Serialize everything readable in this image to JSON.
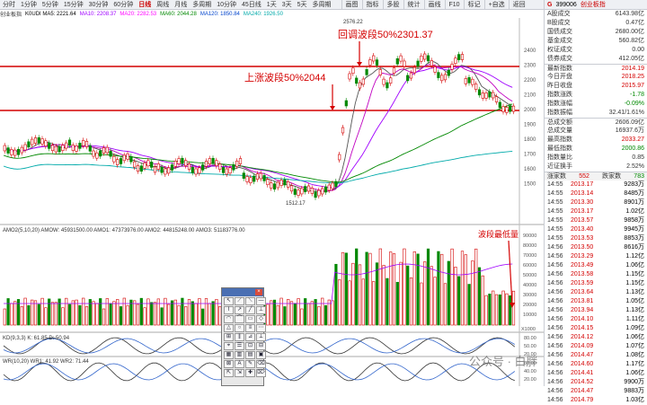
{
  "timeframes": [
    "分时",
    "1分钟",
    "5分钟",
    "15分钟",
    "30分钟",
    "60分钟",
    "日线",
    "周线",
    "月线",
    "多周期",
    "10分钟",
    "45日线",
    "1天",
    "3天",
    "5天",
    "多周期"
  ],
  "active_timeframe": "日线",
  "toolbar": [
    "画图",
    "指标",
    "多股",
    "统计",
    "画线",
    "F10",
    "标记",
    "+自选",
    "返回"
  ],
  "index_info": {
    "label": "创业板指",
    "ma_line": "K0UDI MA5: 2221.64",
    "ma10": "MA10: 2208.37",
    "ma20": "MA20: 2282.53",
    "ma60": "MA60: 2044.28",
    "ma120": "MA120: 1850.84",
    "ma250": "MA240: 1926.50"
  },
  "annotations": {
    "callback": "回调波段50%2301.37",
    "rise": "上涨波段50%2044",
    "peak": "2576.22",
    "low": "1512.17",
    "low_vol": "波段最低量"
  },
  "price_axis": [
    "2400",
    "2300",
    "2200",
    "2100",
    "2000",
    "1900",
    "1800",
    "1700",
    "1600",
    "1500"
  ],
  "vol_axis": [
    "90000",
    "80000",
    "70000",
    "60000",
    "50000",
    "40000",
    "30000",
    "20000",
    "10000"
  ],
  "vol_unit": "X1000",
  "indicators": {
    "vol": "AMO2(5,10,20)  AMOW: 45931500.00  AMO1: 47373976.00  AMO2: 44815248.00  AMO3: 51183776.00",
    "kdj": "KD(9,3,3)  K: 61.85  D: 50.94",
    "wr": "WR(10,20)  WR1: 41.92  WR2: 71.44",
    "kdj_axis": [
      "80.00",
      "50.00",
      "20.00"
    ],
    "wr_axis": [
      "80.00",
      "40.00",
      "20.00"
    ]
  },
  "right_panel": {
    "flag": "G",
    "code": "399006",
    "name": "创业板指",
    "stats": [
      {
        "label": "A股成交",
        "value": "6143.98亿"
      },
      {
        "label": "B股成交",
        "value": "0.47亿"
      },
      {
        "label": "国债成交",
        "value": "2680.00亿"
      },
      {
        "label": "基金成交",
        "value": "560.82亿"
      },
      {
        "label": "权证成交",
        "value": "0.00"
      },
      {
        "label": "债券成交",
        "value": "412.05亿"
      },
      {
        "label": "最新指数",
        "value": "2014.19"
      },
      {
        "label": "今日开盘",
        "value": "2018.25"
      },
      {
        "label": "昨日收盘",
        "value": "2015.97"
      },
      {
        "label": "指数涨跌",
        "value": "-1.78"
      },
      {
        "label": "指数涨幅",
        "value": "-0.09%"
      },
      {
        "label": "指数振幅",
        "value": "32.41/1.61%"
      },
      {
        "label": "总成交额",
        "value": "2606.09亿"
      },
      {
        "label": "总成交量",
        "value": "16937.6万"
      },
      {
        "label": "最高指数",
        "value": "2033.27"
      },
      {
        "label": "最低指数",
        "value": "2000.86"
      },
      {
        "label": "指数量比",
        "value": "0.85"
      },
      {
        "label": "近证换手",
        "value": "2.52%"
      }
    ],
    "rise_label": "涨家数",
    "rise_value": "552",
    "fall_label": "跌家数",
    "fall_value": "783",
    "ticks": [
      {
        "t": "14:55",
        "p": "2013.17",
        "q": "9283万"
      },
      {
        "t": "14:55",
        "p": "2013.14",
        "q": "8485万"
      },
      {
        "t": "14:55",
        "p": "2013.30",
        "q": "8901万"
      },
      {
        "t": "14:55",
        "p": "2013.17",
        "q": "1.02亿"
      },
      {
        "t": "14:55",
        "p": "2013.57",
        "q": "9858万"
      },
      {
        "t": "14:55",
        "p": "2013.40",
        "q": "9945万"
      },
      {
        "t": "14:55",
        "p": "2013.53",
        "q": "8853万"
      },
      {
        "t": "14:56",
        "p": "2013.50",
        "q": "8616万"
      },
      {
        "t": "14:56",
        "p": "2013.29",
        "q": "1.12亿"
      },
      {
        "t": "14:56",
        "p": "2013.49",
        "q": "1.06亿"
      },
      {
        "t": "14:56",
        "p": "2013.58",
        "q": "1.15亿"
      },
      {
        "t": "14:56",
        "p": "2013.59",
        "q": "1.15亿"
      },
      {
        "t": "14:56",
        "p": "2013.64",
        "q": "1.13亿"
      },
      {
        "t": "14:56",
        "p": "2013.81",
        "q": "1.05亿"
      },
      {
        "t": "14:56",
        "p": "2013.94",
        "q": "1.13亿"
      },
      {
        "t": "14:56",
        "p": "2014.10",
        "q": "1.11亿"
      },
      {
        "t": "14:56",
        "p": "2014.15",
        "q": "1.09亿"
      },
      {
        "t": "14:56",
        "p": "2014.12",
        "q": "1.06亿"
      },
      {
        "t": "14:56",
        "p": "2014.09",
        "q": "1.07亿"
      },
      {
        "t": "14:56",
        "p": "2014.47",
        "q": "1.08亿"
      },
      {
        "t": "14:56",
        "p": "2014.60",
        "q": "1.17亿"
      },
      {
        "t": "14:56",
        "p": "2014.41",
        "q": "1.06亿"
      },
      {
        "t": "14:56",
        "p": "2014.52",
        "q": "9900万"
      },
      {
        "t": "14:56",
        "p": "2014.47",
        "q": "9883万"
      },
      {
        "t": "14:56",
        "p": "2014.79",
        "q": "1.03亿"
      }
    ]
  },
  "tools": [
    "↖",
    "⟋",
    "⟍",
    "—",
    "⌇",
    "↗",
    "╱",
    "⊥",
    "◠",
    "⌒",
    "▭",
    "◇",
    "△",
    "○",
    "≡",
    "⋯",
    "⊞",
    "∥",
    "⊿",
    "⟂",
    "⌖",
    "☰",
    "⊡",
    "⊟",
    "▦",
    "▥",
    "▤",
    "▣",
    "⊠",
    "A",
    "✎",
    "⌫",
    "⇱",
    "⇲",
    "✚",
    "⌦"
  ],
  "watermark": "公众号 · 白胖"
}
